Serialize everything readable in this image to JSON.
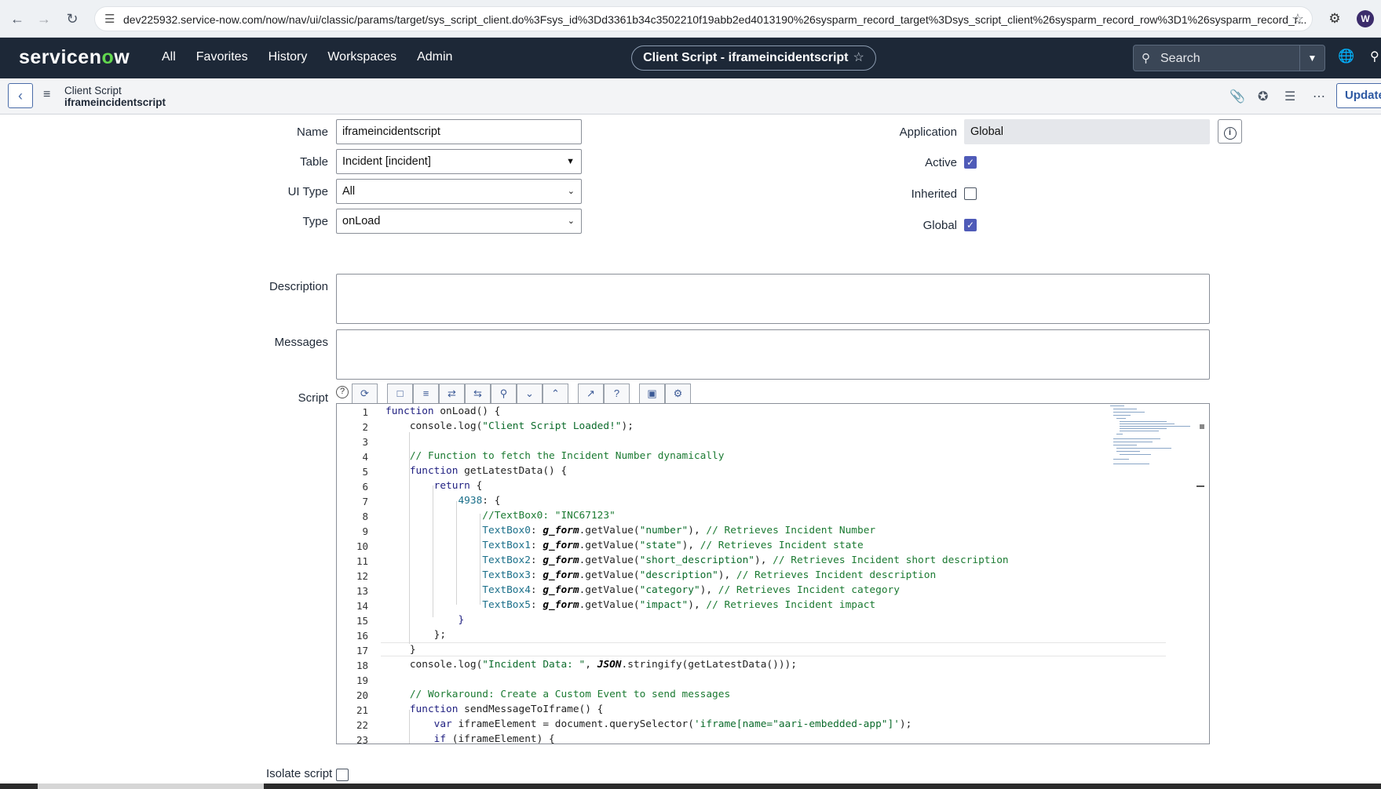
{
  "browser": {
    "url": "dev225932.service-now.com/now/nav/ui/classic/params/target/sys_script_client.do%3Fsys_id%3Dd3361b34c3502210f19abb2ed4013190%26sysparm_record_target%3Dsys_script_client%26sysparm_record_row%3D1%26sysparm_record_r...",
    "profile_initial": "W"
  },
  "nav": {
    "logo_a": "servicen",
    "logo_o": "o",
    "logo_b": "w",
    "links": [
      "All",
      "Favorites",
      "History",
      "Workspaces",
      "Admin"
    ],
    "context_title": "Client Script - iframeincidentscript",
    "search_placeholder": "Search"
  },
  "header": {
    "record_type": "Client Script",
    "record_name": "iframeincidentscript",
    "update_label": "Update"
  },
  "form": {
    "name_label": "Name",
    "name_value": "iframeincidentscript",
    "table_label": "Table",
    "table_value": "Incident [incident]",
    "ui_type_label": "UI Type",
    "ui_type_value": "All",
    "type_label": "Type",
    "type_value": "onLoad",
    "application_label": "Application",
    "application_value": "Global",
    "active_label": "Active",
    "active": true,
    "inherited_label": "Inherited",
    "inherited": false,
    "global_label": "Global",
    "global": true,
    "description_label": "Description",
    "messages_label": "Messages",
    "script_label": "Script",
    "isolate_label": "Isolate script"
  },
  "script": {
    "line_numbers": [
      "1",
      "2",
      "3",
      "4",
      "5",
      "6",
      "7",
      "8",
      "9",
      "10",
      "11",
      "12",
      "13",
      "14",
      "15",
      "16",
      "17",
      "18",
      "19",
      "20",
      "21",
      "22",
      "23"
    ]
  }
}
